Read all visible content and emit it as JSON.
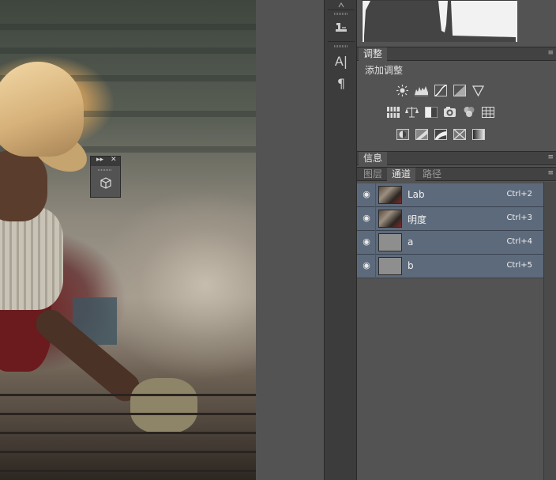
{
  "dock": {
    "icons": [
      "clone-stamp-preset-icon",
      "character-icon",
      "paragraph-icon"
    ],
    "character_glyph": "A|",
    "paragraph_glyph": "¶"
  },
  "adjustments": {
    "tab_label": "调整",
    "title": "添加调整",
    "icons_row1": [
      "brightness-contrast-icon",
      "levels-icon",
      "curves-icon",
      "exposure-icon",
      "vibrance-icon"
    ],
    "icons_row2": [
      "hue-saturation-icon",
      "color-balance-icon",
      "black-white-icon",
      "photo-filter-icon",
      "channel-mixer-icon",
      "color-lookup-icon"
    ],
    "icons_row3": [
      "invert-icon",
      "posterize-icon",
      "threshold-icon",
      "selective-color-icon",
      "gradient-map-icon"
    ]
  },
  "info": {
    "tab_label": "信息"
  },
  "layers_panel": {
    "tabs": [
      "图层",
      "通道",
      "路径"
    ],
    "active_tab": "通道"
  },
  "channels": [
    {
      "name": "Lab",
      "shortcut": "Ctrl+2",
      "thumb": "photo"
    },
    {
      "name": "明度",
      "shortcut": "Ctrl+3",
      "thumb": "photo"
    },
    {
      "name": "a",
      "shortcut": "Ctrl+4",
      "thumb": "gray"
    },
    {
      "name": "b",
      "shortcut": "Ctrl+5",
      "thumb": "gray"
    }
  ],
  "floater": {
    "expand_glyph": "▸▸",
    "close_glyph": "✕",
    "icon": "3d-cube-icon"
  },
  "panel_menu_glyph": "≡",
  "colors": {
    "panel_bg": "#535353",
    "channel_row_selected": "#5d6a7b",
    "dock_bg": "#3c3c3c"
  }
}
